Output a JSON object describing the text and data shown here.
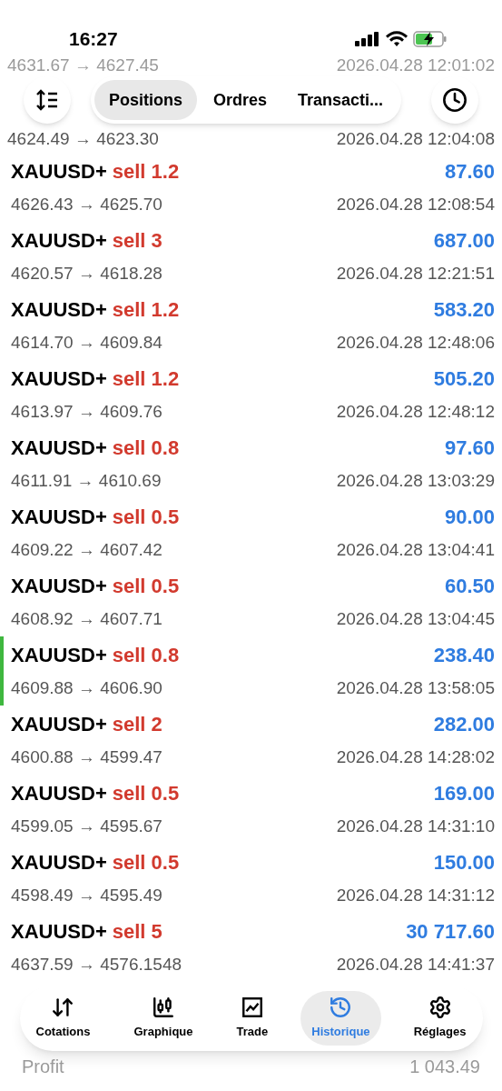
{
  "status_bar": {
    "time": "16:27"
  },
  "top_faded": {
    "prices": "4631.67 → 4627.45",
    "time": "2026.04.28 12:01:02"
  },
  "tabs": [
    {
      "label": "Positions",
      "selected": true
    },
    {
      "label": "Ordres",
      "selected": false
    },
    {
      "label": "Transacti...",
      "selected": false
    }
  ],
  "partial_row": {
    "prices": "4624.49 → 4623.30",
    "time": "2026.04.28 12:04:08"
  },
  "deals": [
    {
      "symbol": "XAUUSD+",
      "side": "sell 1.2",
      "profit": "87.60",
      "prices": "4626.43 → 4625.70",
      "time": "2026.04.28 12:08:54",
      "marked": false
    },
    {
      "symbol": "XAUUSD+",
      "side": "sell 3",
      "profit": "687.00",
      "prices": "4620.57 → 4618.28",
      "time": "2026.04.28 12:21:51",
      "marked": false
    },
    {
      "symbol": "XAUUSD+",
      "side": "sell 1.2",
      "profit": "583.20",
      "prices": "4614.70 → 4609.84",
      "time": "2026.04.28 12:48:06",
      "marked": false
    },
    {
      "symbol": "XAUUSD+",
      "side": "sell 1.2",
      "profit": "505.20",
      "prices": "4613.97 → 4609.76",
      "time": "2026.04.28 12:48:12",
      "marked": false
    },
    {
      "symbol": "XAUUSD+",
      "side": "sell 0.8",
      "profit": "97.60",
      "prices": "4611.91 → 4610.69",
      "time": "2026.04.28 13:03:29",
      "marked": false
    },
    {
      "symbol": "XAUUSD+",
      "side": "sell 0.5",
      "profit": "90.00",
      "prices": "4609.22 → 4607.42",
      "time": "2026.04.28 13:04:41",
      "marked": false
    },
    {
      "symbol": "XAUUSD+",
      "side": "sell 0.5",
      "profit": "60.50",
      "prices": "4608.92 → 4607.71",
      "time": "2026.04.28 13:04:45",
      "marked": false
    },
    {
      "symbol": "XAUUSD+",
      "side": "sell 0.8",
      "profit": "238.40",
      "prices": "4609.88 → 4606.90",
      "time": "2026.04.28 13:58:05",
      "marked": true
    },
    {
      "symbol": "XAUUSD+",
      "side": "sell 2",
      "profit": "282.00",
      "prices": "4600.88 → 4599.47",
      "time": "2026.04.28 14:28:02",
      "marked": false
    },
    {
      "symbol": "XAUUSD+",
      "side": "sell 0.5",
      "profit": "169.00",
      "prices": "4599.05 → 4595.67",
      "time": "2026.04.28 14:31:10",
      "marked": false
    },
    {
      "symbol": "XAUUSD+",
      "side": "sell 0.5",
      "profit": "150.00",
      "prices": "4598.49 → 4595.49",
      "time": "2026.04.28 14:31:12",
      "marked": false
    },
    {
      "symbol": "XAUUSD+",
      "side": "sell 5",
      "profit": "30 717.60",
      "prices": "4637.59 → 4576.1548",
      "time": "2026.04.28 14:41:37",
      "marked": false
    }
  ],
  "nav": [
    {
      "label": "Cotations",
      "kind": "quotes",
      "selected": false
    },
    {
      "label": "Graphique",
      "kind": "chart",
      "selected": false
    },
    {
      "label": "Trade",
      "kind": "trade",
      "selected": false
    },
    {
      "label": "Historique",
      "kind": "history",
      "selected": true
    },
    {
      "label": "Réglages",
      "kind": "settings",
      "selected": false
    }
  ],
  "summary": {
    "label": "Profit",
    "value": "1 043.49"
  }
}
